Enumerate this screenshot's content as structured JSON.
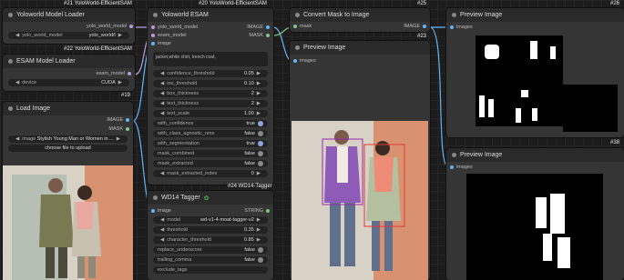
{
  "nodes": {
    "yolo_loader": {
      "badge": "#21 YoloWorld-EfficientSAM",
      "title": "Yoloworld Model Loader",
      "row": {
        "label": "yolo_world_model",
        "value": "yolo_world/l"
      },
      "footer_badge": "#22 YoloWorld-EfficientSAM"
    },
    "esam_loader": {
      "title": "ESAM Model Loader",
      "output": "esam_model",
      "row": {
        "label": "device",
        "value": "CUDA"
      },
      "footer_badge": "#19"
    },
    "load_image": {
      "title": "Load Image",
      "outputs": [
        "IMAGE",
        "MASK"
      ],
      "row": {
        "label": "image",
        "value": "Stylish Young Man or Women in ..."
      },
      "upload": "choose file to upload"
    },
    "yolo_esam": {
      "badge": "#20 YoloWorld-EfficientSAM",
      "title": "Yoloworld ESAM",
      "inputs": [
        "yolo_world_model",
        "esam_model",
        "image"
      ],
      "outputs": [
        "IMAGE",
        "MASK"
      ],
      "text": "jacket,white shirt, trench coat,",
      "params": [
        {
          "label": "confidence_threshold",
          "value": "0.05"
        },
        {
          "label": "iou_threshold",
          "value": "0.10"
        },
        {
          "label": "box_thickness",
          "value": "2"
        },
        {
          "label": "text_thickness",
          "value": "2"
        },
        {
          "label": "text_scale",
          "value": "1.00"
        },
        {
          "label": "with_confidence",
          "value": "true"
        },
        {
          "label": "with_class_agnostic_nms",
          "value": "false"
        },
        {
          "label": "with_segmentation",
          "value": "true"
        },
        {
          "label": "mask_combined",
          "value": "false"
        },
        {
          "label": "mask_extracted",
          "value": "false"
        },
        {
          "label": "mask_extracted_index",
          "value": "0"
        }
      ],
      "footer_badge": "#24 WD14-Tagger"
    },
    "wd14": {
      "title": "WD14 Tagger",
      "input": "image",
      "output": "STRING",
      "params": [
        {
          "label": "model",
          "value": "wd-v1-4-moat-tagger-v2"
        },
        {
          "label": "threshold",
          "value": "0.35"
        },
        {
          "label": "character_threshold",
          "value": "0.85"
        },
        {
          "label": "replace_underscore",
          "value": "false"
        },
        {
          "label": "trailing_comma",
          "value": "false"
        },
        {
          "label": "exclude_tags",
          "value": ""
        }
      ]
    },
    "convert_mask": {
      "badge": "#25",
      "title": "Convert Mask to Image",
      "input": "mask",
      "output": "IMAGE",
      "footer_badge": "#23"
    },
    "preview1": {
      "title": "Preview Image",
      "input": "images"
    },
    "preview2": {
      "badge": "#26",
      "title": "Preview Image",
      "input": "images",
      "footer_badge": "#38"
    },
    "preview3": {
      "title": "Preview Image",
      "input": "images"
    }
  },
  "colors": {
    "model": "#b39ddb",
    "image": "#64b5f6",
    "mask": "#81c784",
    "string": "#77c67a"
  }
}
